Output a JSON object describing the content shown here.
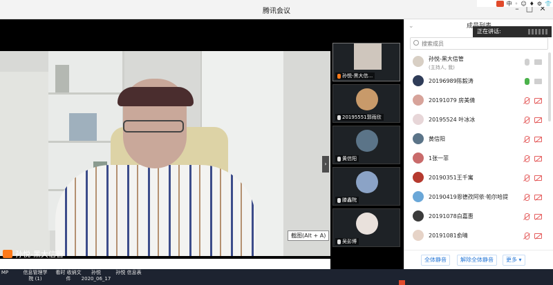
{
  "window": {
    "title": "腾讯会议"
  },
  "tray": {
    "glyphs": [
      "中",
      "◦",
      "☺",
      "♦",
      "⚙",
      "👕"
    ]
  },
  "stage": {
    "speaker_name": "孙悦-黑大信管",
    "tooltip": "截图(Alt + A)",
    "collapse_glyph": "›"
  },
  "thumbnails": [
    {
      "name": "孙悦-黑大信...",
      "avatar_color": "#cfc6bd"
    },
    {
      "name": "20195551郭雨欣",
      "avatar_color": "#c89a6a"
    },
    {
      "name": "黄信阳",
      "avatar_color": "#5b7488"
    },
    {
      "name": "滕鑫院",
      "avatar_color": "#8ba3c6"
    },
    {
      "name": "吴彭博",
      "avatar_color": "#e9e1dc"
    }
  ],
  "panel": {
    "header": "成员列表",
    "speaking_label": "正在讲话:",
    "search_placeholder": "搜索成员",
    "members": [
      {
        "name": "孙悦-黑大信管",
        "sub": "(主持人, 我)",
        "avatar_color": "#d8cfc4",
        "muted": false,
        "active": false
      },
      {
        "name": "20196989陈毅涛",
        "sub": "",
        "avatar_color": "#2f3c58",
        "muted": false,
        "active": true
      },
      {
        "name": "20191079 房美倩",
        "sub": "",
        "avatar_color": "#d7a39a",
        "muted": true,
        "active": false
      },
      {
        "name": "20195524 叶冰冰",
        "sub": "",
        "avatar_color": "#e7d6d8",
        "muted": true,
        "active": false
      },
      {
        "name": "黄信阳",
        "sub": "",
        "avatar_color": "#5b7488",
        "muted": true,
        "active": false
      },
      {
        "name": "1张一菲",
        "sub": "",
        "avatar_color": "#c96b6b",
        "muted": true,
        "active": false
      },
      {
        "name": "20190351王千寓",
        "sub": "",
        "avatar_color": "#b53a2f",
        "muted": true,
        "active": false
      },
      {
        "name": "20190419恩德孜阿依·帕尔哈提",
        "sub": "",
        "avatar_color": "#6aa7d8",
        "muted": true,
        "active": false
      },
      {
        "name": "20191078白嘉惠",
        "sub": "",
        "avatar_color": "#3b3b3b",
        "muted": true,
        "active": false
      },
      {
        "name": "20191081俞晴",
        "sub": "",
        "avatar_color": "#e6d3c7",
        "muted": true,
        "active": false
      },
      {
        "name": "",
        "sub": "",
        "avatar_color": "#c8cfd8",
        "muted": true,
        "active": false
      }
    ],
    "footer": {
      "mute_all": "全体静音",
      "unmute_all": "解除全体静音",
      "more": "更多 ▾"
    }
  },
  "taskbar": {
    "items": [
      {
        "line1": "MP",
        "line2": ""
      },
      {
        "line1": "信息管理学",
        "line2": "院 (1)"
      },
      {
        "line1": "看时 收纳文",
        "line2": "件"
      },
      {
        "line1": "孙悦",
        "line2": "2020_06_17"
      },
      {
        "line1": "孙悦 信息表",
        "line2": ""
      }
    ]
  },
  "colors": {
    "accent": "#2a7ad8",
    "mic_active": "#4bb24b",
    "muted": "#e45c5c",
    "speaker_badge": "#ff7a1a"
  }
}
